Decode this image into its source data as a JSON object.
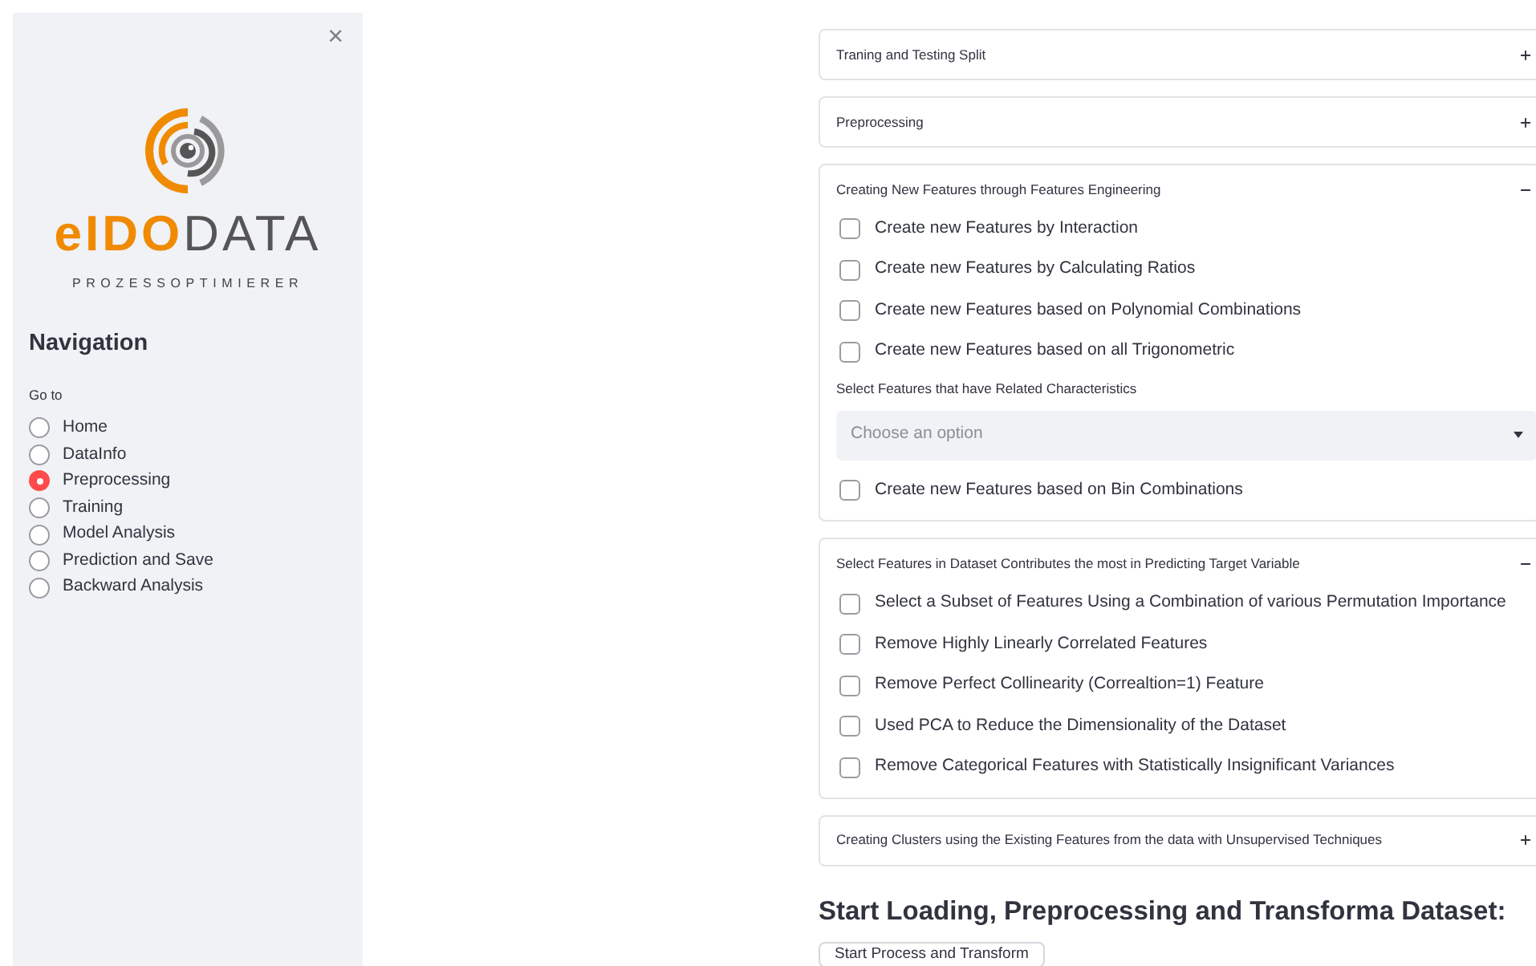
{
  "sidebar": {
    "close": "×",
    "logo": {
      "brand_main": "eIDO",
      "brand_accent": "DATA",
      "tagline": "PROZESSOPTIMIERER"
    },
    "title": "Navigation",
    "radio_label": "Go to",
    "items": [
      {
        "label": "Home",
        "selected": false
      },
      {
        "label": "DataInfo",
        "selected": false
      },
      {
        "label": "Preprocessing",
        "selected": true
      },
      {
        "label": "Training",
        "selected": false
      },
      {
        "label": "Model Analysis",
        "selected": false
      },
      {
        "label": "Prediction and Save",
        "selected": false
      },
      {
        "label": "Backward Analysis",
        "selected": false
      }
    ]
  },
  "expanders": [
    {
      "title": "Traning and Testing Split",
      "expanded": false
    },
    {
      "title": "Preprocessing",
      "expanded": false
    },
    {
      "title": "Creating New Features through Features Engineering",
      "expanded": true,
      "items": [
        {
          "kind": "checkbox",
          "label": "Create new Features by Interaction",
          "checked": false
        },
        {
          "kind": "checkbox",
          "label": "Create new Features by Calculating Ratios",
          "checked": false
        },
        {
          "kind": "checkbox",
          "label": "Create new Features based on Polynomial Combinations",
          "checked": false
        },
        {
          "kind": "checkbox",
          "label": "Create new Features based on all Trigonometric",
          "checked": false
        },
        {
          "kind": "select",
          "label": "Select Features that have Related Characteristics",
          "placeholder": "Choose an option"
        },
        {
          "kind": "checkbox",
          "label": "Create new Features based on Bin Combinations",
          "checked": false
        }
      ]
    },
    {
      "title": "Select Features in Dataset Contributes the most in Predicting Target Variable",
      "expanded": true,
      "items": [
        {
          "kind": "checkbox",
          "label": "Select a Subset of Features Using a Combination of various Permutation Importance",
          "checked": false
        },
        {
          "kind": "checkbox",
          "label": "Remove Highly Linearly Correlated Features",
          "checked": false
        },
        {
          "kind": "checkbox",
          "label": "Remove Perfect Collinearity (Correaltion=1) Feature",
          "checked": false
        },
        {
          "kind": "checkbox",
          "label": "Used PCA to Reduce the Dimensionality of the Dataset",
          "checked": false
        },
        {
          "kind": "checkbox",
          "label": "Remove Categorical Features with Statistically Insignificant Variances",
          "checked": false
        }
      ]
    },
    {
      "title": "Creating Clusters using the Existing Features from the data with Unsupervised Techniques",
      "expanded": false
    }
  ],
  "heading": "Start Loading, Preprocessing and Transforma Dataset:",
  "button": "Start Process and Transform"
}
